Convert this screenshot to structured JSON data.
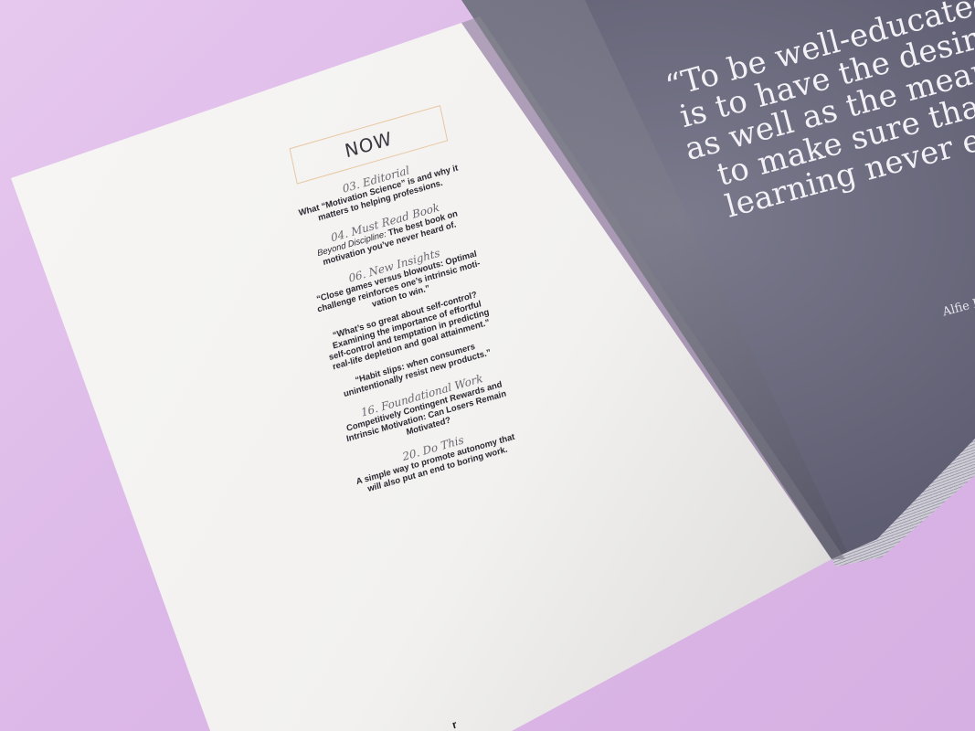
{
  "left_page": {
    "section_header": "NOW",
    "sections": [
      {
        "title": "03. Editorial",
        "lines": [
          "What “Motivation Science” is and why it",
          "matters to helping professions."
        ]
      },
      {
        "title": "04. Must Read Book",
        "lead_italic": "Beyond Discipline:",
        "lines": [
          " The best book on",
          "motivation you’ve never heard of."
        ]
      },
      {
        "title": "06. New Insights",
        "lines": [
          "“Close games versus blowouts: Optimal",
          "challenge reinforces one’s intrinsic moti-",
          "vation to win.”"
        ],
        "lines2": [
          "“What’s so great about self-control?",
          "Examining the importance of effortful",
          "self-control and temptation in predicting",
          "real-life depletion and goal attainment.”"
        ],
        "lines3": [
          "“Habit slips: when consumers",
          "unintentionally resist new products.”"
        ]
      },
      {
        "title": "16. Foundational Work",
        "lines": [
          "Competitively Contingent Rewards and",
          "Intrinsic Motivation: Can Losers Remain",
          "Motivated?"
        ]
      },
      {
        "title": "20. Do This",
        "lines": [
          "A simple way to promote autonomy that",
          "will also put an end to boring work."
        ]
      }
    ],
    "footer_mark": "r"
  },
  "right_page": {
    "quote_lines": [
      "“To be well-educated",
      "is to have the desire",
      "as well as the means",
      "to make sure that",
      "learning never en"
    ],
    "author": "Alfie K"
  },
  "colors": {
    "background": "#dcb8e8",
    "right_page": "#5f5e72",
    "left_page": "#f2f1ef",
    "box_border": "#e7c7a0"
  }
}
